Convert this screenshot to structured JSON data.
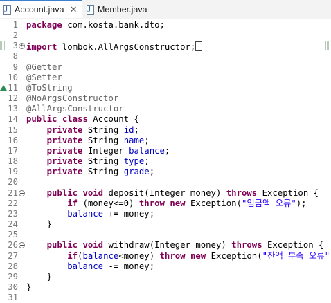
{
  "tabs": [
    {
      "label": "Account.java",
      "active": true
    },
    {
      "label": "Member.java",
      "active": false
    }
  ],
  "colors": {
    "keyword": "#7f0055",
    "field": "#0000c0",
    "string": "#2a00ff",
    "annotation": "#646464",
    "line_number": "#787878"
  },
  "code": {
    "lines": [
      {
        "n": "1",
        "tokens": [
          [
            "kw",
            "package"
          ],
          [
            "t",
            " com.kosta.bank.dto;"
          ]
        ]
      },
      {
        "n": "2",
        "tokens": []
      },
      {
        "n": "3",
        "tokens": [
          [
            "kw",
            "import"
          ],
          [
            "t",
            " lombok.AllArgsConstructor;"
          ]
        ]
      },
      {
        "n": "8",
        "tokens": []
      },
      {
        "n": "9",
        "tokens": [
          [
            "ann",
            "@Getter"
          ]
        ]
      },
      {
        "n": "10",
        "tokens": [
          [
            "ann",
            "@Setter"
          ]
        ]
      },
      {
        "n": "11",
        "tokens": [
          [
            "ann",
            "@ToString"
          ]
        ]
      },
      {
        "n": "12",
        "tokens": [
          [
            "ann",
            "@NoArgsConstructor"
          ]
        ]
      },
      {
        "n": "13",
        "tokens": [
          [
            "ann",
            "@AllArgsConstructor"
          ]
        ]
      },
      {
        "n": "14",
        "tokens": [
          [
            "kw",
            "public"
          ],
          [
            "t",
            " "
          ],
          [
            "kw",
            "class"
          ],
          [
            "t",
            " Account {"
          ]
        ]
      },
      {
        "n": "15",
        "tokens": [
          [
            "t",
            "    "
          ],
          [
            "kw",
            "private"
          ],
          [
            "t",
            " String "
          ],
          [
            "fld",
            "id"
          ],
          [
            "t",
            ";"
          ]
        ]
      },
      {
        "n": "16",
        "tokens": [
          [
            "t",
            "    "
          ],
          [
            "kw",
            "private"
          ],
          [
            "t",
            " String "
          ],
          [
            "fld",
            "name"
          ],
          [
            "t",
            ";"
          ]
        ]
      },
      {
        "n": "17",
        "tokens": [
          [
            "t",
            "    "
          ],
          [
            "kw",
            "private"
          ],
          [
            "t",
            " Integer "
          ],
          [
            "fld",
            "balance"
          ],
          [
            "t",
            ";"
          ]
        ]
      },
      {
        "n": "18",
        "tokens": [
          [
            "t",
            "    "
          ],
          [
            "kw",
            "private"
          ],
          [
            "t",
            " String "
          ],
          [
            "fld",
            "type"
          ],
          [
            "t",
            ";"
          ]
        ]
      },
      {
        "n": "19",
        "tokens": [
          [
            "t",
            "    "
          ],
          [
            "kw",
            "private"
          ],
          [
            "t",
            " String "
          ],
          [
            "fld",
            "grade"
          ],
          [
            "t",
            ";"
          ]
        ]
      },
      {
        "n": "20",
        "tokens": []
      },
      {
        "n": "21",
        "tokens": [
          [
            "t",
            "    "
          ],
          [
            "kw",
            "public"
          ],
          [
            "t",
            " "
          ],
          [
            "kw",
            "void"
          ],
          [
            "t",
            " deposit(Integer money) "
          ],
          [
            "kw",
            "throws"
          ],
          [
            "t",
            " Exception {"
          ]
        ]
      },
      {
        "n": "22",
        "tokens": [
          [
            "t",
            "        "
          ],
          [
            "kw",
            "if"
          ],
          [
            "t",
            " (money<=0) "
          ],
          [
            "kw",
            "throw"
          ],
          [
            "t",
            " "
          ],
          [
            "kw",
            "new"
          ],
          [
            "t",
            " Exception("
          ],
          [
            "str",
            "\"입금액 오류\""
          ],
          [
            "t",
            ");"
          ]
        ]
      },
      {
        "n": "23",
        "tokens": [
          [
            "t",
            "        "
          ],
          [
            "fld",
            "balance"
          ],
          [
            "t",
            " += money;"
          ]
        ]
      },
      {
        "n": "24",
        "tokens": [
          [
            "t",
            "    }"
          ]
        ]
      },
      {
        "n": "25",
        "tokens": []
      },
      {
        "n": "26",
        "tokens": [
          [
            "t",
            "    "
          ],
          [
            "kw",
            "public"
          ],
          [
            "t",
            " "
          ],
          [
            "kw",
            "void"
          ],
          [
            "t",
            " withdraw(Integer money) "
          ],
          [
            "kw",
            "throws"
          ],
          [
            "t",
            " Exception {"
          ]
        ]
      },
      {
        "n": "27",
        "tokens": [
          [
            "t",
            "        "
          ],
          [
            "kw",
            "if"
          ],
          [
            "t",
            "("
          ],
          [
            "fld",
            "balance"
          ],
          [
            "t",
            "<money) "
          ],
          [
            "kw",
            "throw"
          ],
          [
            "t",
            " "
          ],
          [
            "kw",
            "new"
          ],
          [
            "t",
            " Exception("
          ],
          [
            "str",
            "\"잔액 부족 오류\""
          ],
          [
            "t",
            ");"
          ]
        ]
      },
      {
        "n": "28",
        "tokens": [
          [
            "t",
            "        "
          ],
          [
            "fld",
            "balance"
          ],
          [
            "t",
            " -= money;"
          ]
        ]
      },
      {
        "n": "29",
        "tokens": [
          [
            "t",
            "    }"
          ]
        ]
      },
      {
        "n": "30",
        "tokens": [
          [
            "t",
            "}"
          ]
        ]
      },
      {
        "n": "31",
        "tokens": []
      }
    ]
  }
}
